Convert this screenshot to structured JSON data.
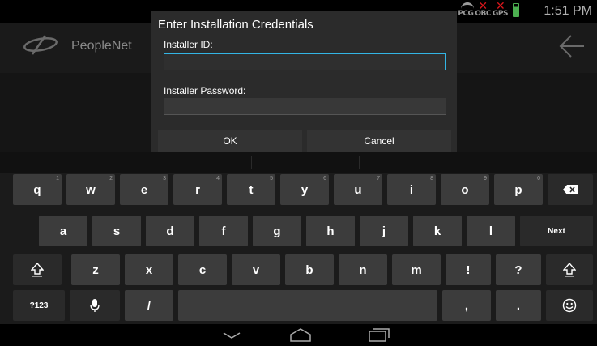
{
  "status_bar": {
    "icons": [
      {
        "text": "PCG",
        "icon": "wifi-icon"
      },
      {
        "text": "OBC",
        "icon": "x-icon"
      },
      {
        "text": "GPS",
        "icon": "x-icon"
      }
    ],
    "time": "1:51 PM"
  },
  "app": {
    "name": "PeopleNet"
  },
  "dialog": {
    "title": "Enter Installation Credentials",
    "installer_id_label": "Installer ID:",
    "installer_id_value": "",
    "password_label": "Installer Password:",
    "password_value": "",
    "ok_label": "OK",
    "cancel_label": "Cancel"
  },
  "keyboard": {
    "row1": [
      {
        "key": "q",
        "hint": "1"
      },
      {
        "key": "w",
        "hint": "2"
      },
      {
        "key": "e",
        "hint": "3"
      },
      {
        "key": "r",
        "hint": "4"
      },
      {
        "key": "t",
        "hint": "5"
      },
      {
        "key": "y",
        "hint": "6"
      },
      {
        "key": "u",
        "hint": "7"
      },
      {
        "key": "i",
        "hint": "8"
      },
      {
        "key": "o",
        "hint": "9"
      },
      {
        "key": "p",
        "hint": "0"
      }
    ],
    "row2": [
      "a",
      "s",
      "d",
      "f",
      "g",
      "h",
      "j",
      "k",
      "l"
    ],
    "next_label": "Next",
    "row3": [
      "z",
      "x",
      "c",
      "v",
      "b",
      "n",
      "m",
      "!",
      "?"
    ],
    "symbols_label": "?123",
    "slash": "/",
    "comma": ",",
    "period": "."
  },
  "colors": {
    "accent": "#33b5e5",
    "key_bg": "#3c3c3c",
    "dialog_bg": "#2b2b2b"
  }
}
